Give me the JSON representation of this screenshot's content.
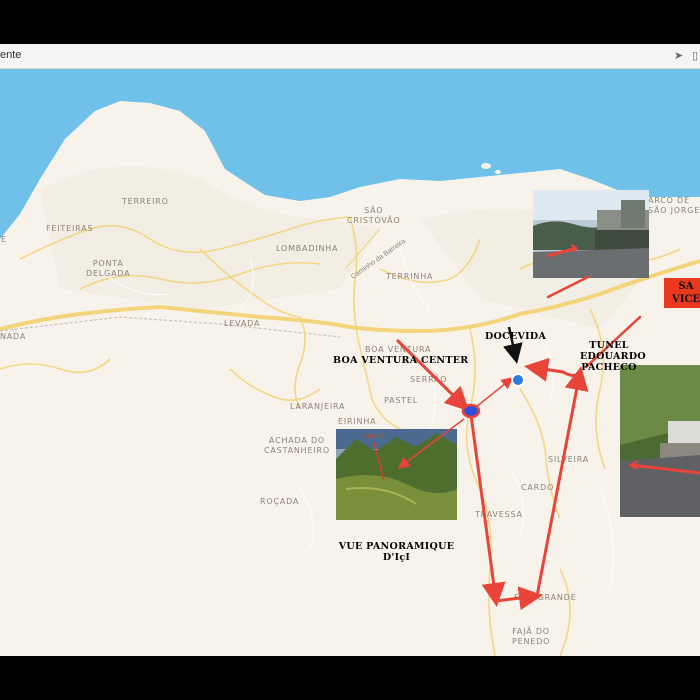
{
  "window": {
    "title": "ente"
  },
  "colors": {
    "sea": "#6fc1e9",
    "land": "#f8f3ea",
    "road": "#f3d47a",
    "route": "#e8443a",
    "marker": "#2f7be4"
  },
  "places": {
    "terreiro": "TERREIRO",
    "feiteiras": "FEITEIRAS",
    "ponta_delgada": "PONTA\nDELGADA",
    "lombadinha": "LOMBADINHA",
    "sao_cristovao": "SÃO\nCRISTÓVÃO",
    "terrinha": "TERRINHA",
    "levada": "LEVADA",
    "boa_ventura": "BOA VENTURA",
    "serrao": "SERRÃO",
    "pastel": "PASTEL",
    "laranjeira": "LARANJEIRA",
    "eirinha": "EIRINHA",
    "achada": "ACHADA DO\nCASTANHEIRO",
    "rocada": "ROÇADA",
    "silveira": "SILVEIRA",
    "cardo": "CARDO",
    "travessa": "TRAVESSA",
    "faja_grande": "FAJÃ GRANDE",
    "faja_penedo": "FAJÃ DO\nPENEDO",
    "arco": "ARCO DE\nSÃO JORGE",
    "left_frag": "E",
    "left_frag2": "NADA",
    "road_name": "Caminho da Barreira"
  },
  "annotations": {
    "boa_ventura_center": "BOA VENTURA CENTER",
    "docevida": "DOCEVIDA",
    "tunel": "TUNEL\nEDOUARDO\nPACHECO",
    "vue": "VUE PANORAMIQUE\nD'IçI",
    "sao_vicente": "SA\nVICE"
  }
}
